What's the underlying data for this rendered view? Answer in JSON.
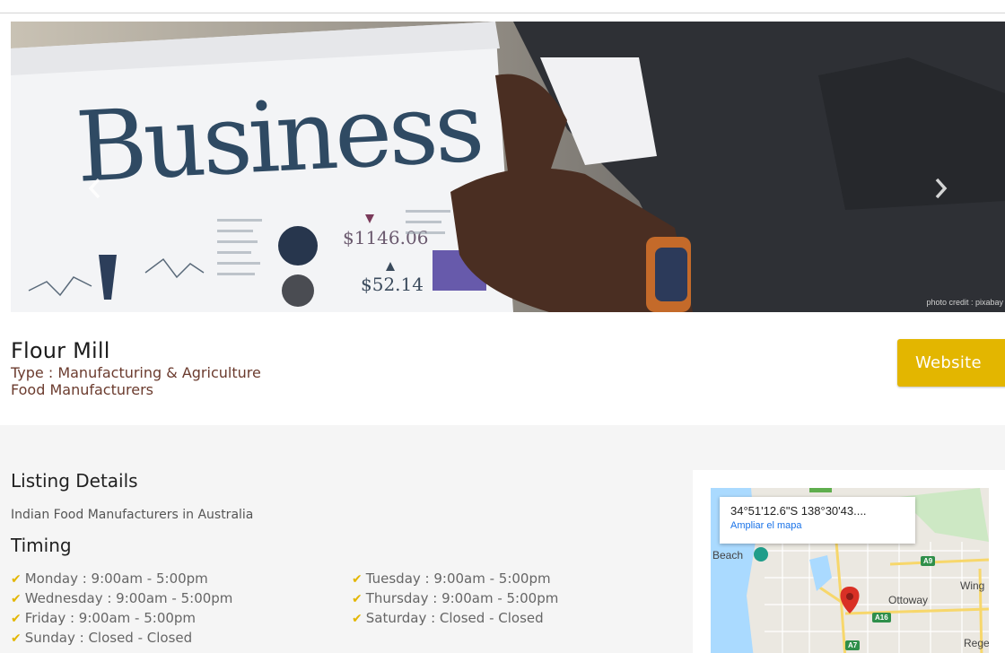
{
  "hero": {
    "headline_image_text": "Business",
    "photo_credit": "photo credit : pixabay",
    "prev_arrow_icon": "chevron-left-icon",
    "next_arrow_icon": "chevron-right-icon"
  },
  "listing": {
    "title": "Flour Mill",
    "type": "Type : Manufacturing & Agriculture",
    "category": "Food Manufacturers",
    "website_label": "Website"
  },
  "details": {
    "heading": "Listing Details",
    "description": "Indian Food Manufacturers in Australia"
  },
  "timing": {
    "heading": "Timing",
    "items": [
      "Monday : 9:00am - 5:00pm",
      "Tuesday : 9:00am - 5:00pm",
      "Wednesday : 9:00am - 5:00pm",
      "Thursday : 9:00am - 5:00pm",
      "Friday : 9:00am - 5:00pm",
      "Saturday : Closed - Closed",
      "Sunday : Closed - Closed"
    ]
  },
  "map": {
    "coordinates": "34°51'12.6\"S 138°30'43....",
    "enlarge_link": "Ampliar el mapa",
    "labels": {
      "beach": "Beach",
      "ottoway": "Ottoway",
      "wingfield": "Wing",
      "regency": "Rege"
    },
    "shields": [
      "A9",
      "A16",
      "A7"
    ]
  },
  "colors": {
    "accent": "#e3b600",
    "type_text": "#6b3b2e",
    "section_bg": "#f5f5f5",
    "link": "#1a73e8",
    "marker": "#d93025"
  }
}
